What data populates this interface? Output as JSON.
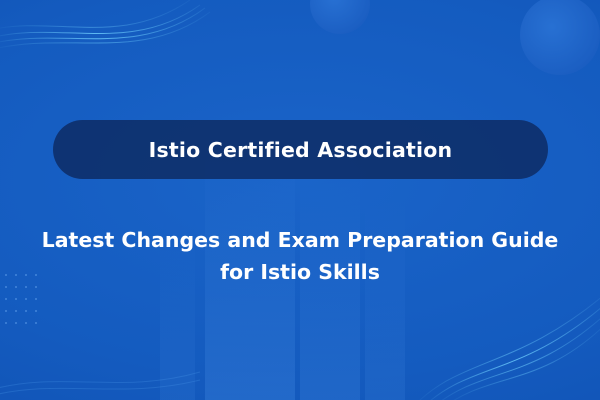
{
  "banner": {
    "title": "Istio Certified Association",
    "subtitle_line1": "Latest Changes and Exam Preparation Guide",
    "subtitle_line2": "for Istio Skills"
  },
  "colors": {
    "background": "#145bbf",
    "pill": "#0e2e68",
    "text": "#ffffff",
    "wave": "#4fc3ff"
  }
}
